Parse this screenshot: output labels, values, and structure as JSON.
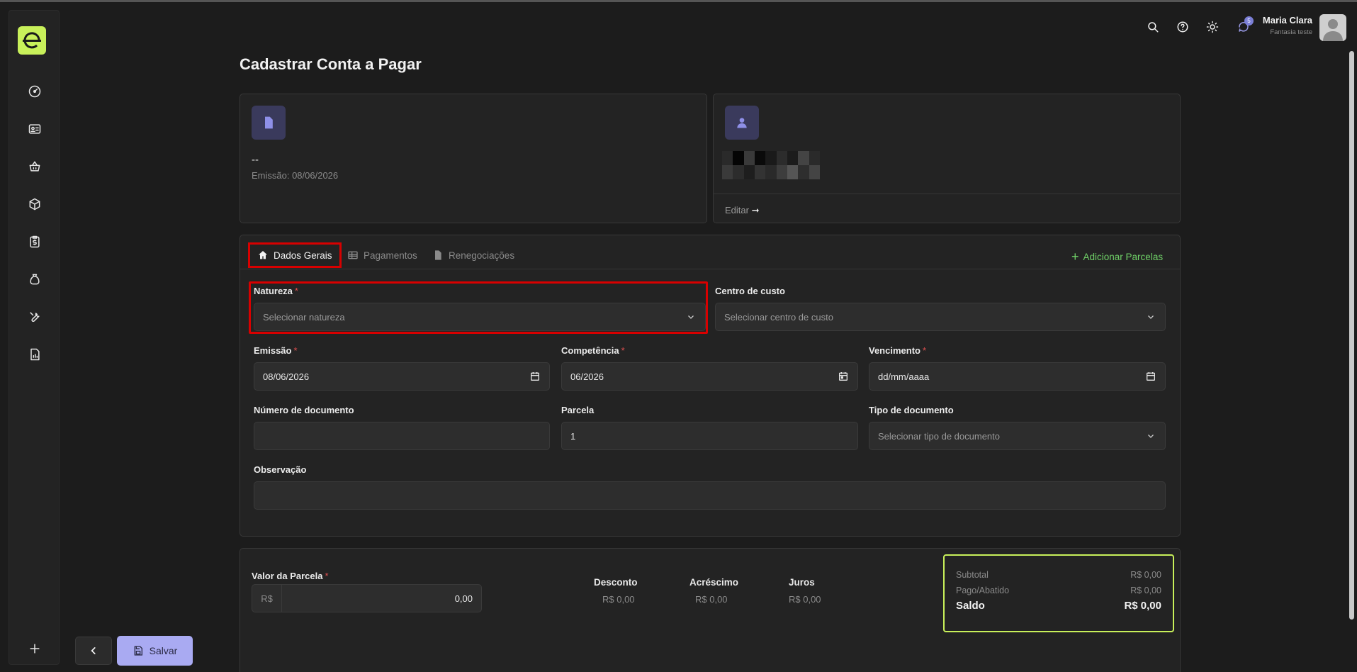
{
  "user": {
    "name": "Maria Clara",
    "subtitle": "Fantasia teste",
    "notifications": "5"
  },
  "page": {
    "title": "Cadastrar Conta a Pagar"
  },
  "document_card": {
    "number": "--",
    "emission": "Emissão: 08/06/2026"
  },
  "supplier_card": {
    "edit_label": "Editar",
    "edit_arrow": "➞"
  },
  "tabs": [
    {
      "label": "Dados Gerais",
      "icon": "home-icon"
    },
    {
      "label": "Pagamentos",
      "icon": "table-icon"
    },
    {
      "label": "Renegociações",
      "icon": "document-icon"
    }
  ],
  "add_parcelas": "Adicionar Parcelas",
  "form": {
    "natureza": {
      "label": "Natureza",
      "placeholder": "Selecionar natureza"
    },
    "centro_custo": {
      "label": "Centro de custo",
      "placeholder": "Selecionar centro de custo"
    },
    "emissao": {
      "label": "Emissão",
      "value": "08/06/2026"
    },
    "competencia": {
      "label": "Competência",
      "value": "06/2026"
    },
    "vencimento": {
      "label": "Vencimento",
      "value": "dd/mm/aaaa"
    },
    "numero_documento": {
      "label": "Número de documento",
      "value": ""
    },
    "parcela": {
      "label": "Parcela",
      "value": "1"
    },
    "tipo_documento": {
      "label": "Tipo de documento",
      "placeholder": "Selecionar tipo de documento"
    },
    "observacao": {
      "label": "Observação",
      "value": ""
    },
    "required_mark": "*"
  },
  "values": {
    "valor_parcela_label": "Valor da Parcela",
    "currency": "R$",
    "valor_parcela": "0,00",
    "desconto_label": "Desconto",
    "desconto": "R$ 0,00",
    "acrescimo_label": "Acréscimo",
    "acrescimo": "R$ 0,00",
    "juros_label": "Juros",
    "juros": "R$ 0,00"
  },
  "summary": {
    "subtotal_label": "Subtotal",
    "subtotal": "R$ 0,00",
    "pago_label": "Pago/Abatido",
    "pago": "R$ 0,00",
    "saldo_label": "Saldo",
    "saldo": "R$ 0,00"
  },
  "actions": {
    "save_label": "Salvar"
  },
  "colors": {
    "accent": "#c8f05a",
    "primary_button": "#a9aaf2",
    "highlight": "#d80000",
    "success": "#6fd067"
  }
}
